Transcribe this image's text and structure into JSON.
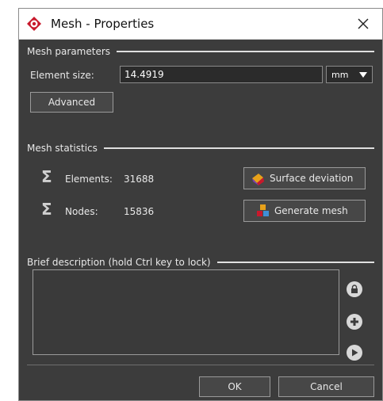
{
  "window": {
    "title": "Mesh - Properties"
  },
  "mesh_parameters": {
    "section_label": "Mesh parameters",
    "element_size_label": "Element size:",
    "element_size_value": "14.4919",
    "unit": "mm",
    "advanced_label": "Advanced"
  },
  "mesh_statistics": {
    "section_label": "Mesh statistics",
    "elements_label": "Elements:",
    "elements_value": "31688",
    "nodes_label": "Nodes:",
    "nodes_value": "15836",
    "surface_deviation_label": "Surface deviation",
    "generate_mesh_label": "Generate mesh"
  },
  "description": {
    "section_label": "Brief description (hold Ctrl key to lock)",
    "text": ""
  },
  "footer": {
    "ok_label": "OK",
    "cancel_label": "Cancel"
  },
  "colors": {
    "brand": "#c8192c",
    "background": "#3c3c3c"
  }
}
